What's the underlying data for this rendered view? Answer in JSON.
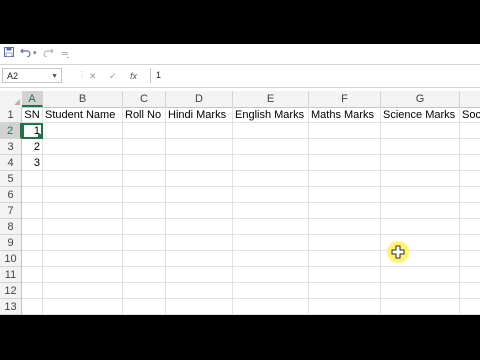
{
  "quick_access": {
    "save_icon": "save-icon",
    "undo_icon": "undo-icon",
    "redo_icon": "redo-icon",
    "customize_icon": "customize-icon"
  },
  "formula_bar": {
    "name_box": "A2",
    "formula_value": "1",
    "cancel_glyph": "✕",
    "enter_glyph": "✓",
    "fx_glyph": "fx"
  },
  "columns": [
    {
      "letter": "A",
      "header": "SN"
    },
    {
      "letter": "B",
      "header": "Student Name"
    },
    {
      "letter": "C",
      "header": "Roll No"
    },
    {
      "letter": "D",
      "header": "Hindi Marks"
    },
    {
      "letter": "E",
      "header": "English Marks"
    },
    {
      "letter": "F",
      "header": "Maths Marks"
    },
    {
      "letter": "G",
      "header": "Science Marks"
    },
    {
      "letter": "H",
      "header": "Soc"
    }
  ],
  "rows": [
    "1",
    "2",
    "3",
    "4",
    "5",
    "6",
    "7",
    "8",
    "9",
    "10",
    "11",
    "12",
    "13"
  ],
  "sn_values": [
    "1",
    "2",
    "3"
  ],
  "selected_cell": "A2",
  "colors": {
    "accent": "#217346",
    "cursor_highlight": "#fff36a"
  }
}
